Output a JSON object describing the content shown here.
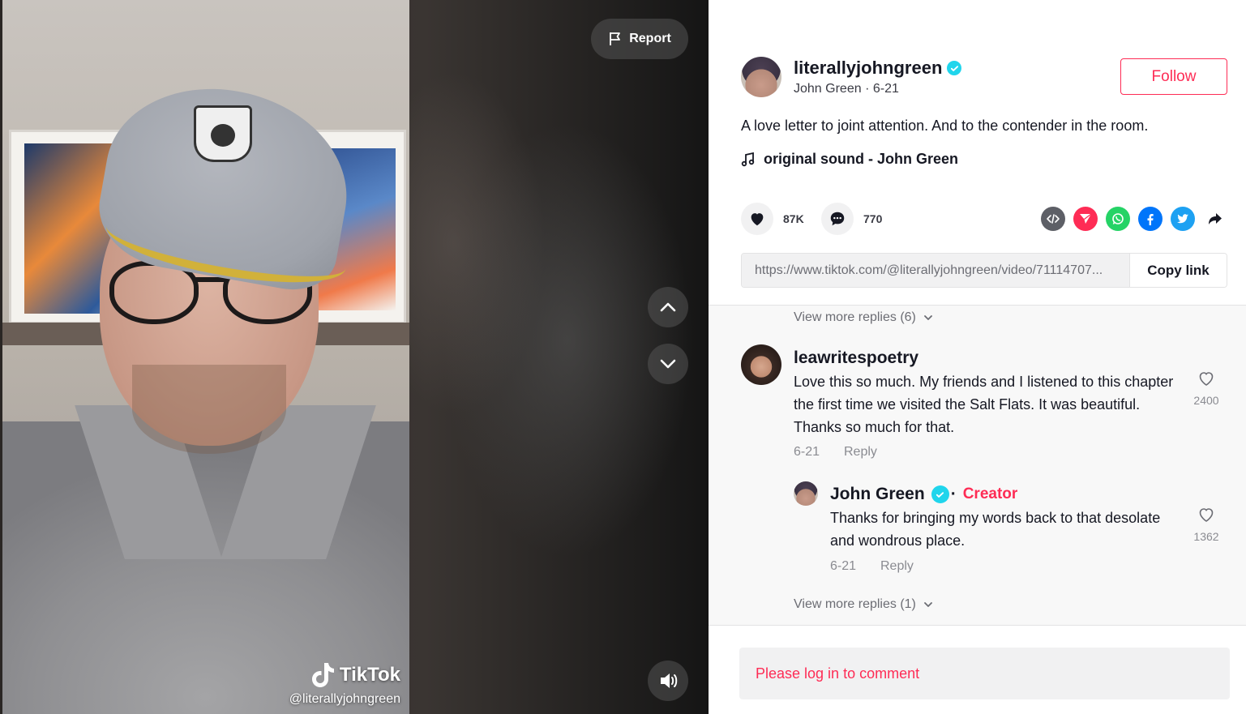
{
  "video": {
    "report_label": "Report",
    "watermark_brand": "TikTok",
    "watermark_handle": "@literallyjohngreen"
  },
  "author": {
    "handle": "literallyjohngreen",
    "name": "John Green",
    "date": "6-21",
    "follow_label": "Follow"
  },
  "post": {
    "caption": "A love letter to joint attention. And to the contender in the room.",
    "sound": "original sound - John Green",
    "likes": "87K",
    "comments": "770",
    "url": "https://www.tiktok.com/@literallyjohngreen/video/71114707...",
    "copy_link_label": "Copy link"
  },
  "comments": {
    "more_replies_top": "View more replies (6)",
    "more_replies_bottom": "View more replies (1)",
    "items": [
      {
        "user": "leawritespoetry",
        "text": "Love this so much. My friends and I listened to this chapter the first time we visited the Salt Flats. It was beautiful. Thanks so much for that.",
        "date": "6-21",
        "reply_label": "Reply",
        "likes": "2400"
      },
      {
        "user": "John Green",
        "creator_label": "Creator",
        "text": "Thanks for bringing my words back to that desolate and wondrous place.",
        "date": "6-21",
        "reply_label": "Reply",
        "likes": "1362"
      }
    ]
  },
  "login_prompt": "Please log in to comment",
  "colors": {
    "accent": "#fe2c55",
    "verified": "#20d5ec"
  }
}
